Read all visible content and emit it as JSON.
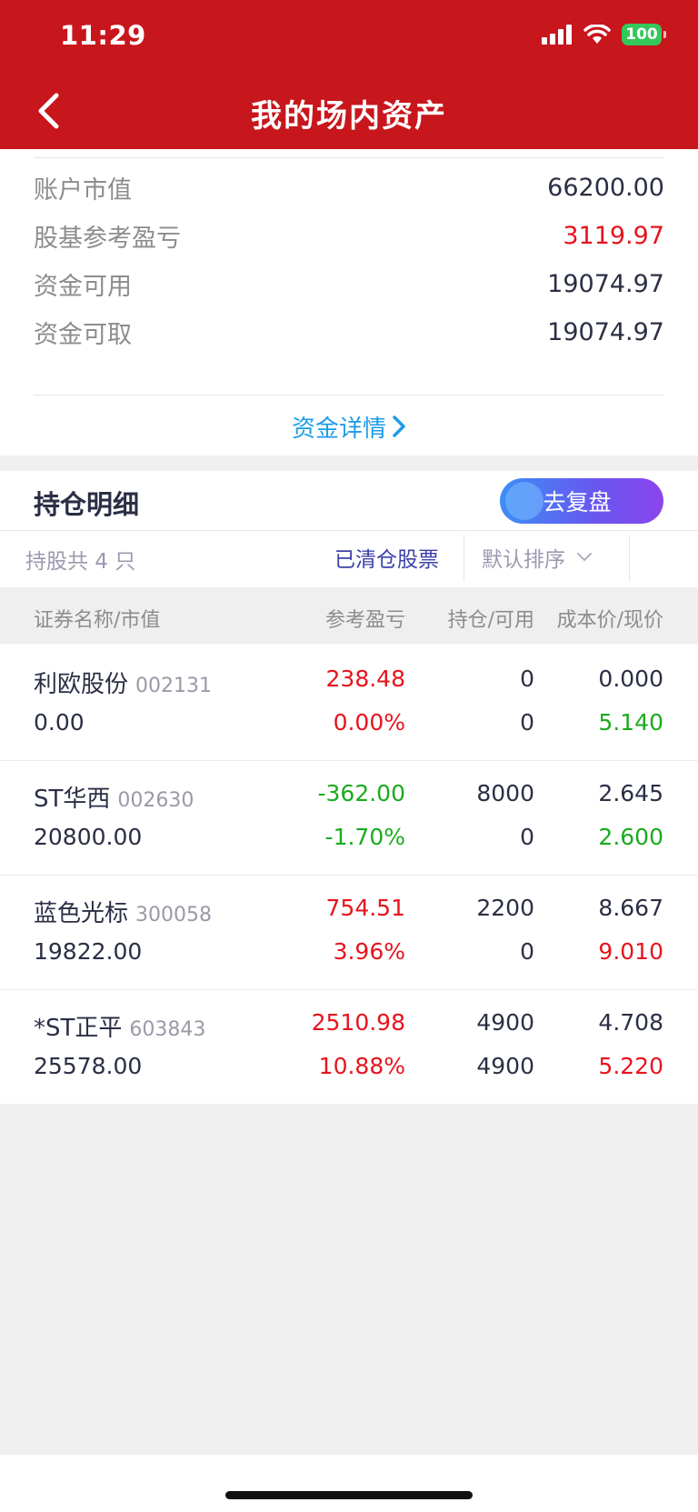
{
  "status_bar": {
    "time": "11:29",
    "battery": "100"
  },
  "nav": {
    "title": "我的场内资产"
  },
  "summary": {
    "rows": [
      {
        "label": "账户市值",
        "value": "66200.00"
      },
      {
        "label": "股基参考盈亏",
        "value": "3119.97"
      },
      {
        "label": "资金可用",
        "value": "19074.97"
      },
      {
        "label": "资金可取",
        "value": "19074.97"
      }
    ],
    "detail_link": "资金详情"
  },
  "holdings": {
    "title": "持仓明细",
    "review_button": "去复盘",
    "count_label": "持股共 4 只",
    "cleared_label": "已清仓股票",
    "sort_label": "默认排序",
    "columns": [
      "证券名称/市值",
      "参考盈亏",
      "持仓/可用",
      "成本价/现价"
    ],
    "rows": [
      {
        "name": "利欧股份",
        "code": "002131",
        "market_value": "0.00",
        "pl": "238.48",
        "pl_pct": "0.00%",
        "position": "0",
        "available": "0",
        "cost": "0.000",
        "price": "5.140"
      },
      {
        "name": "ST华西",
        "code": "002630",
        "market_value": "20800.00",
        "pl": "-362.00",
        "pl_pct": "-1.70%",
        "position": "8000",
        "available": "0",
        "cost": "2.645",
        "price": "2.600"
      },
      {
        "name": "蓝色光标",
        "code": "300058",
        "market_value": "19822.00",
        "pl": "754.51",
        "pl_pct": "3.96%",
        "position": "2200",
        "available": "0",
        "cost": "8.667",
        "price": "9.010"
      },
      {
        "name": "*ST正平",
        "code": "603843",
        "market_value": "25578.00",
        "pl": "2510.98",
        "pl_pct": "10.88%",
        "position": "4900",
        "available": "4900",
        "cost": "4.708",
        "price": "5.220"
      }
    ]
  },
  "colors": {
    "header_red": "#c8161d",
    "gain_red": "#e6141e",
    "loss_green": "#1aab1e",
    "link_blue": "#1c9be8"
  }
}
